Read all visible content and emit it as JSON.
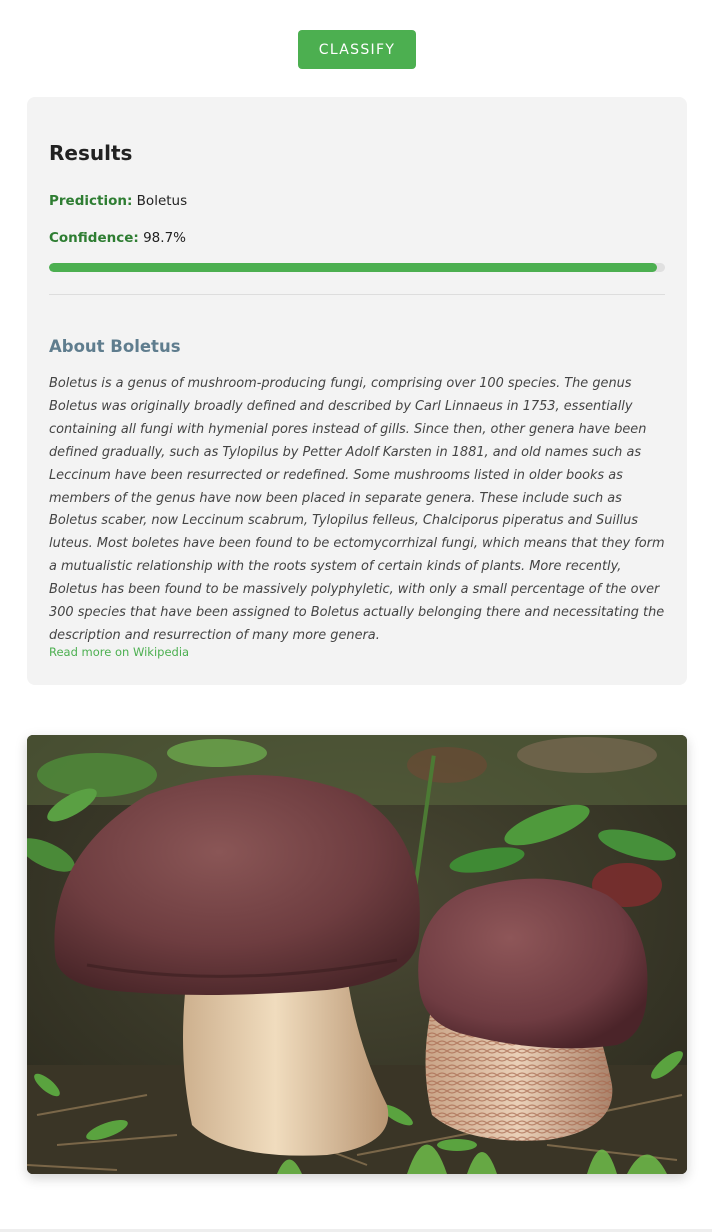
{
  "classify_button": {
    "label": "CLASSIFY"
  },
  "results": {
    "title": "Results",
    "prediction_label": "Prediction:",
    "prediction_value": "Boletus",
    "confidence_label": "Confidence:",
    "confidence_value": "98.7%",
    "confidence_fraction": 0.987
  },
  "about": {
    "title": "About Boletus",
    "description": "Boletus is a genus of mushroom-producing fungi, comprising over 100 species. The genus Boletus was originally broadly defined and described by Carl Linnaeus in 1753, essentially containing all fungi with hymenial pores instead of gills. Since then, other genera have been defined gradually, such as Tylopilus by Petter Adolf Karsten in 1881, and old names such as Leccinum have been resurrected or redefined. Some mushrooms listed in older books as members of the genus have now been placed in separate genera. These include such as Boletus scaber, now Leccinum scabrum, Tylopilus felleus, Chalciporus piperatus and Suillus luteus. Most boletes have been found to be ectomycorrhizal fungi, which means that they form a mutualistic relationship with the roots system of certain kinds of plants. More recently, Boletus has been found to be massively polyphyletic, with only a small percentage of the over 300 species that have been assigned to Boletus actually belonging there and necessitating the description and resurrection of many more genera.",
    "link_label": "Read more on Wikipedia"
  },
  "image": {
    "subject": "boletus-mushrooms-photo"
  },
  "colors": {
    "accent": "#4caf50",
    "label_green": "#2e7d32",
    "card_background": "#f3f3f3",
    "about_title": "#5f7d8e"
  }
}
